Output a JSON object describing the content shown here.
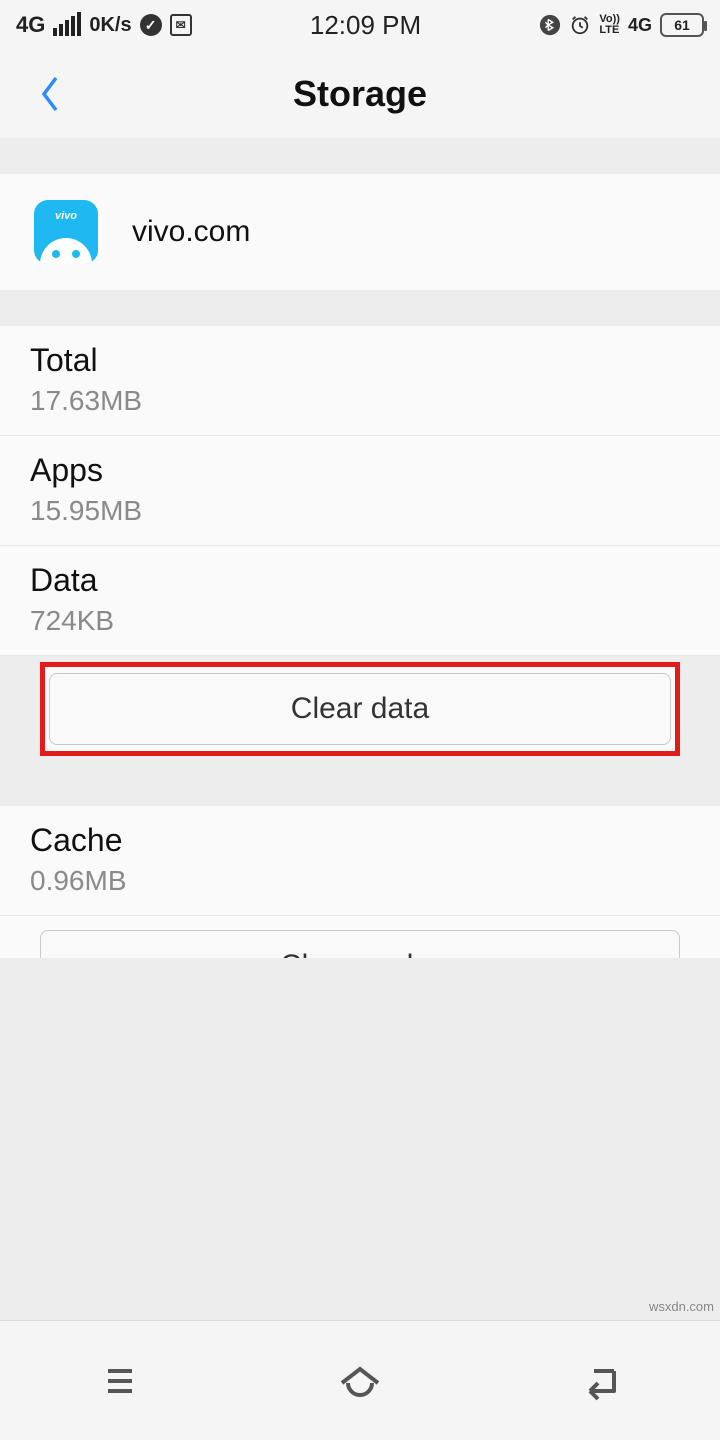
{
  "statusbar": {
    "network_type": "4G",
    "speed": "0K/s",
    "time": "12:09 PM",
    "volte": "Vo))",
    "lte": "LTE",
    "extra": "4G",
    "battery": "61"
  },
  "header": {
    "title": "Storage"
  },
  "app": {
    "name": "vivo.com",
    "brand": "vivo"
  },
  "rows": {
    "total": {
      "label": "Total",
      "value": "17.63MB"
    },
    "apps": {
      "label": "Apps",
      "value": "15.95MB"
    },
    "data": {
      "label": "Data",
      "value": "724KB"
    },
    "cache": {
      "label": "Cache",
      "value": "0.96MB"
    }
  },
  "buttons": {
    "clear_data": "Clear data",
    "clear_cache": "Clear cache"
  },
  "watermark": "wsxdn.com"
}
